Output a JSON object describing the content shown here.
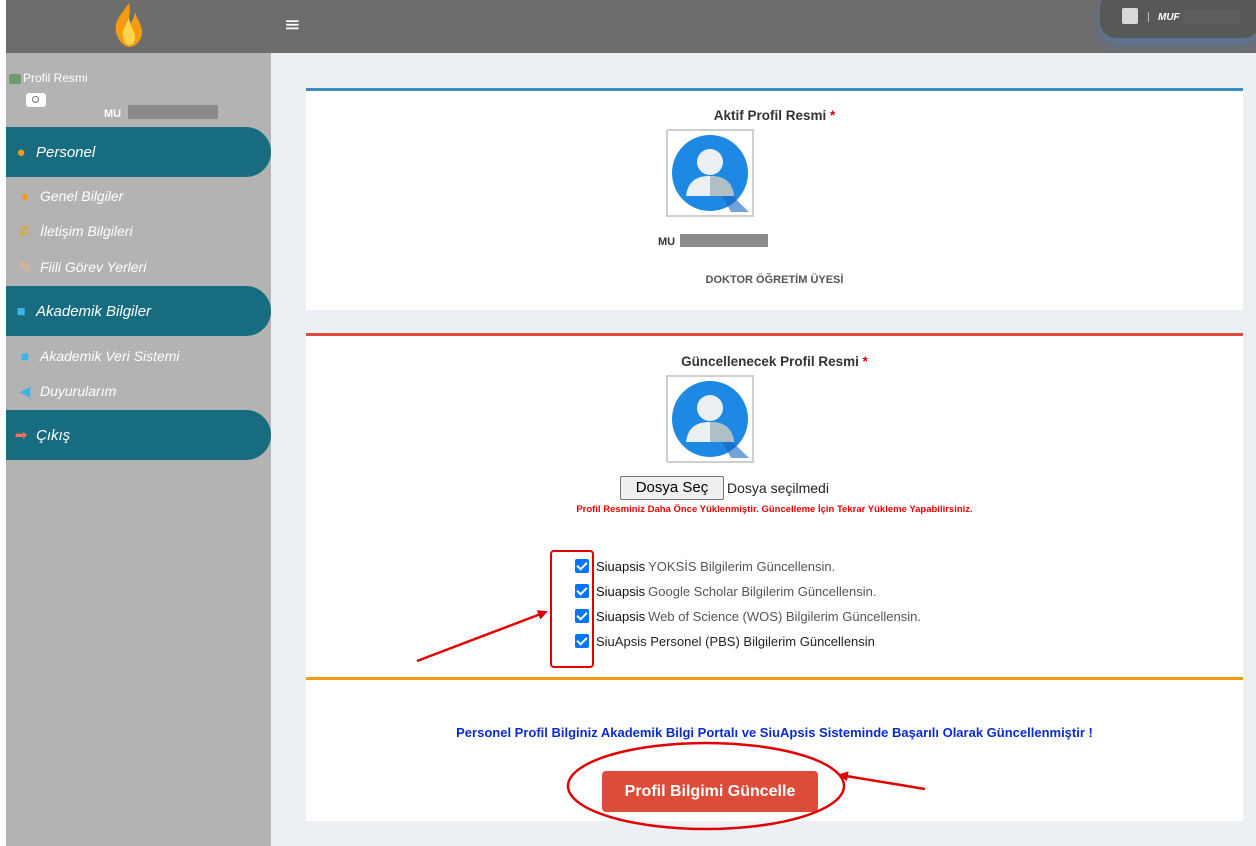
{
  "app": {
    "logo_icon": "flame-logo-icon",
    "menu_icon": "≡",
    "user_name": "MUF"
  },
  "sidebar": {
    "profile_image_alt": "Profil Resmi",
    "profile_name": "MU",
    "menus": [
      {
        "label": "Personel",
        "icon": "user-icon",
        "icon_color": "#f39c12"
      },
      {
        "label": "Akademik Bilgiler",
        "icon": "book-icon",
        "icon_color": "#3c8dbc"
      },
      {
        "label": "Çıkış",
        "icon": "sign-out-icon",
        "icon_color": "#dd4b39"
      }
    ],
    "submenus": [
      {
        "label": "Genel Bilgiler",
        "icon": "user-icon"
      },
      {
        "label": "İletişim Bilgileri",
        "icon": "phone-icon"
      },
      {
        "label": "Fiili Görev Yerleri",
        "icon": "paperclip-icon"
      },
      {
        "label": "Akademik Veri Sistemi",
        "icon": "book-icon"
      },
      {
        "label": "Duyurularım",
        "icon": "bullhorn-icon"
      }
    ]
  },
  "active_profile": {
    "title": "Aktif Profil Resmi",
    "required_mark": "*",
    "name": "MU",
    "position": "DOKTOR ÖĞRETİM ÜYESİ"
  },
  "update_profile": {
    "title": "Güncellenecek Profil Resmi",
    "required_mark": "*",
    "file_button": "Dosya Seç",
    "file_status": "Dosya seçilmedi",
    "warning": "Profil Resminiz Daha Önce Yüklenmiştir. Güncelleme İçin Tekrar Yükleme Yapabilirsiniz.",
    "checkboxes": [
      {
        "prefix": "Siuapsis",
        "text": "YOKSİS Bilgilerim Güncellensin.",
        "checked": true
      },
      {
        "prefix": "Siuapsis",
        "text": "Google Scholar Bilgilerim Güncellensin.",
        "checked": true
      },
      {
        "prefix": "Siuapsis",
        "text": "Web of Science (WOS) Bilgilerim Güncellensin.",
        "checked": true
      },
      {
        "prefix": "",
        "text": "SiuApsis Personel (PBS) Bilgilerim Güncellensin",
        "checked": true
      }
    ]
  },
  "result": {
    "message": "Personel Profil Bilginiz Akademik Bilgi Portalı ve SiuApsis Sisteminde Başarılı Olarak Güncellenmiştir !",
    "button": "Profil Bilgimi Güncelle"
  },
  "colors": {
    "accent": "#176c80",
    "danger": "#dd4b39",
    "primary": "#3c8dbc",
    "warning": "#f39c12",
    "annotation": "#e00000"
  }
}
